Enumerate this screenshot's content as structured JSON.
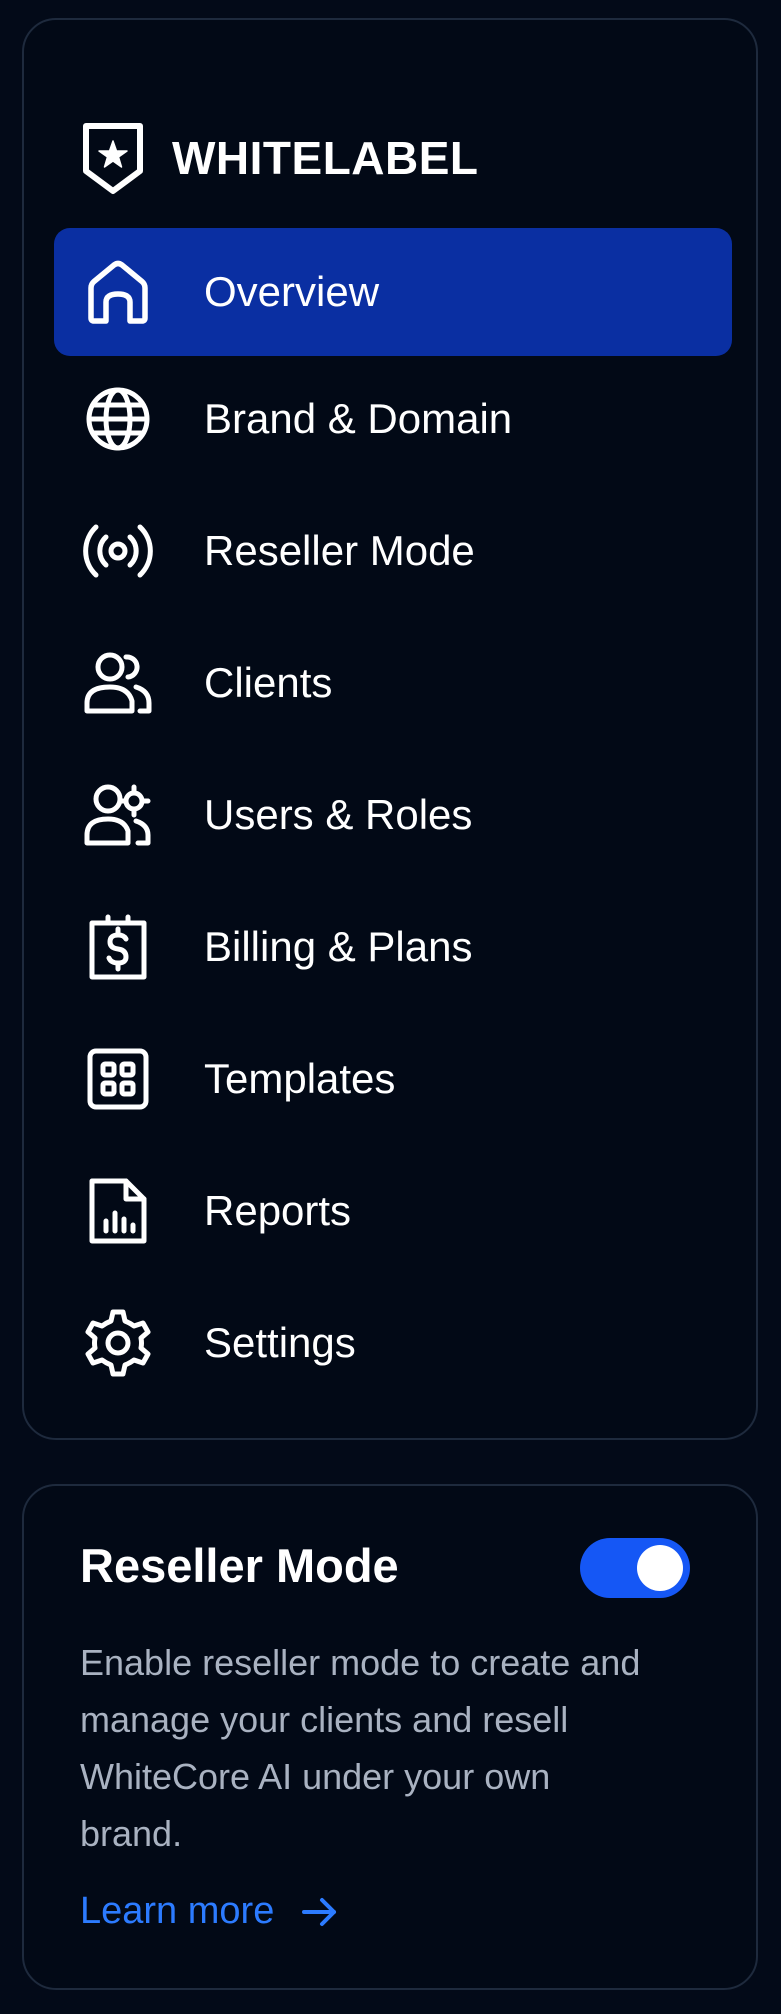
{
  "brand": {
    "name": "WHITELABEL"
  },
  "nav": {
    "items": [
      {
        "label": "Overview",
        "icon": "home-icon",
        "active": true
      },
      {
        "label": "Brand & Domain",
        "icon": "globe-icon",
        "active": false
      },
      {
        "label": "Reseller Mode",
        "icon": "broadcast-icon",
        "active": false
      },
      {
        "label": "Clients",
        "icon": "users-icon",
        "active": false
      },
      {
        "label": "Users & Roles",
        "icon": "user-gear-icon",
        "active": false
      },
      {
        "label": "Billing & Plans",
        "icon": "billing-icon",
        "active": false
      },
      {
        "label": "Templates",
        "icon": "templates-icon",
        "active": false
      },
      {
        "label": "Reports",
        "icon": "report-icon",
        "active": false
      },
      {
        "label": "Settings",
        "icon": "gear-icon",
        "active": false
      }
    ]
  },
  "reseller": {
    "title": "Reseller Mode",
    "enabled": true,
    "description": "Enable reseller mode to create and manage your clients and resell WhiteCore AI under your own brand.",
    "link_label": "Learn more"
  },
  "colors": {
    "background": "#030a18",
    "active_item": "#0a2fa2",
    "toggle_on": "#1557f5",
    "link": "#2c7bff",
    "border": "#1e2a3d"
  }
}
